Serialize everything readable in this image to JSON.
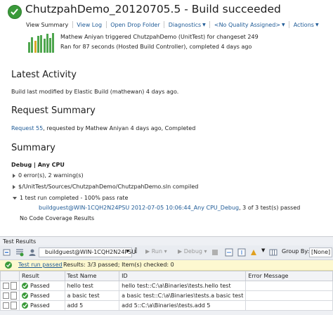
{
  "header": {
    "title": "ChutzpahDemo_20120705.5 - Build succeeded",
    "toolbar": {
      "view_summary": "View Summary",
      "view_log": "View Log",
      "open_drop_folder": "Open Drop Folder",
      "diagnostics": "Diagnostics",
      "quality": "<No Quality Assigned>",
      "actions": "Actions"
    },
    "trigger_line": "Mathew Aniyan triggered ChutzpahDemo (UnitTest) for changeset 249",
    "ran_line": "Ran for 87 seconds (Hosted Build Controller), completed 4 days ago",
    "history_bars": [
      {
        "level": 0.55,
        "status": "pass"
      },
      {
        "level": 0.8,
        "status": "pass"
      },
      {
        "level": 0.6,
        "status": "fail"
      },
      {
        "level": 0.85,
        "status": "pass"
      },
      {
        "level": 0.9,
        "status": "pass"
      },
      {
        "level": 0.7,
        "status": "pass"
      },
      {
        "level": 0.95,
        "status": "pass"
      },
      {
        "level": 0.75,
        "status": "pass"
      },
      {
        "level": 1.0,
        "status": "pass"
      }
    ]
  },
  "latest_activity": {
    "heading": "Latest Activity",
    "text": "Build last modified by Elastic Build (mathewan) 4 days ago."
  },
  "request_summary": {
    "heading": "Request Summary",
    "request_link": "Request 55",
    "text": ", requested by Mathew Aniyan 4 days ago, Completed"
  },
  "summary": {
    "heading": "Summary",
    "config": "Debug | Any CPU",
    "errors": "0 error(s), 2 warning(s)",
    "solution": "$/UnitTest/Sources/ChutzpahDemo/ChutzpahDemo.sln compiled",
    "test_run": "1 test run completed - 100% pass rate",
    "test_run_link": "buildguest@WIN-1CQH2N24PSU 2012-07-05 10:06:44_Any CPU_Debug",
    "test_run_count": ", 3 of 3 test(s) passed",
    "coverage": "No Code Coverage Results"
  },
  "test_results": {
    "panel_title": "Test Results",
    "run_selector": "buildguest@WIN-1CQH2N24PSU",
    "run_label": "Run",
    "debug_label": "Debug",
    "group_by_label": "Group By:",
    "group_by_value": "[None]",
    "status_link": "Test run passed",
    "status_text": "Results: 3/3 passed;  Item(s) checked: 0",
    "columns": [
      "Result",
      "Test Name",
      "ID",
      "Error Message"
    ],
    "rows": [
      {
        "result": "Passed",
        "name": "hello test",
        "id": "hello test::C:\\a\\Binaries\\tests.hello test",
        "error": ""
      },
      {
        "result": "Passed",
        "name": "a basic test",
        "id": "a basic test::C:\\a\\Binaries\\tests.a basic test",
        "error": ""
      },
      {
        "result": "Passed",
        "name": "add 5",
        "id": "add 5::C:\\a\\Binaries\\tests.add 5",
        "error": ""
      }
    ]
  }
}
